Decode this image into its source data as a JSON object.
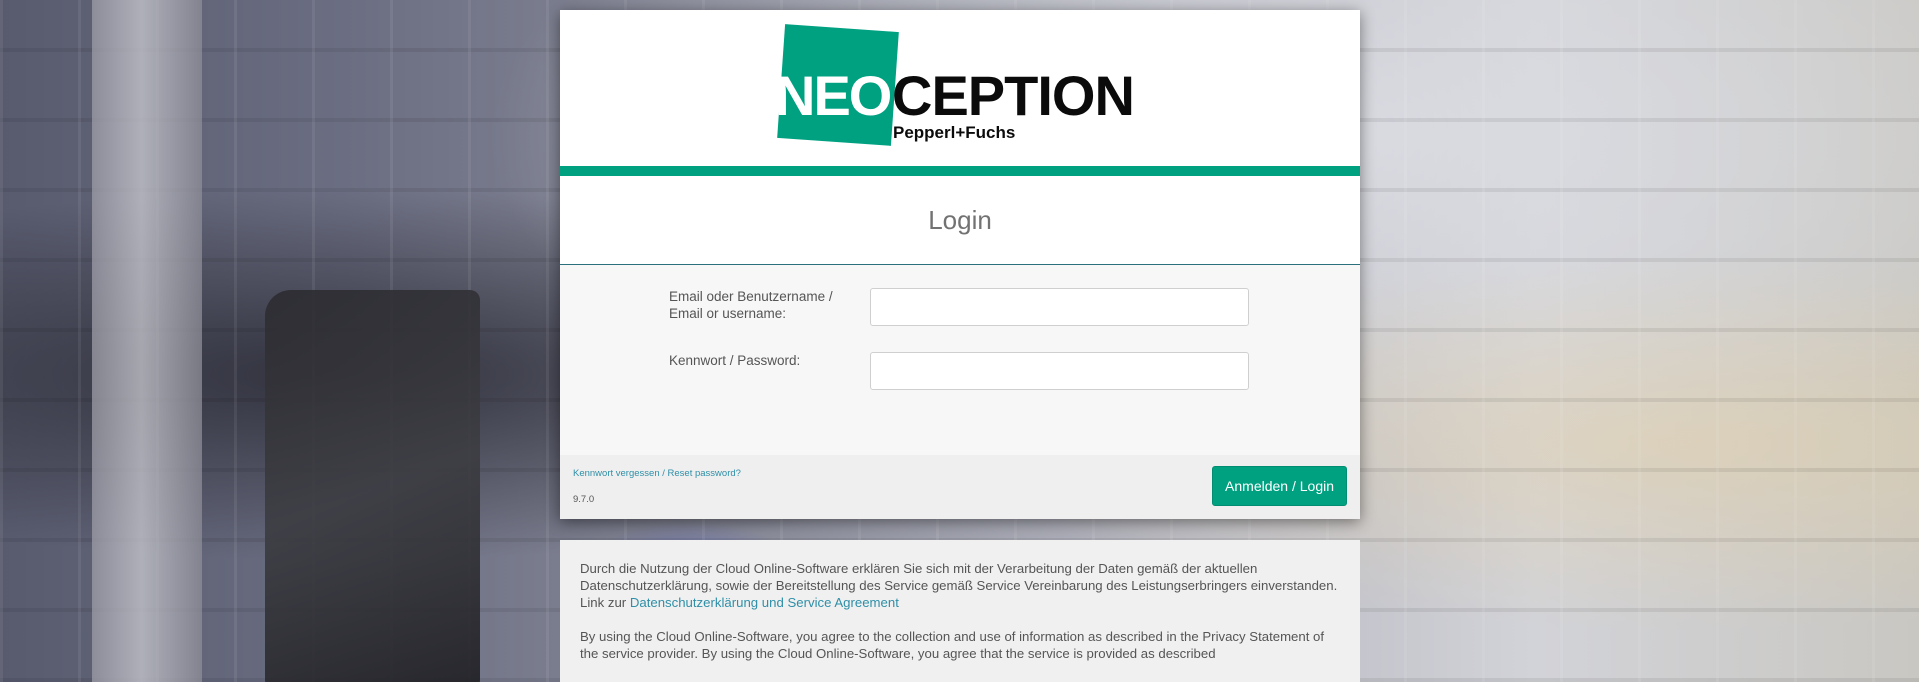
{
  "logo": {
    "brand_neo": "NEO",
    "brand_ception": "CEPTION",
    "brand_sub": "Pepperl+Fuchs"
  },
  "colors": {
    "brand_green": "#00a181",
    "link": "#2f8fa8"
  },
  "login": {
    "title": "Login",
    "username_label_de": "Email oder Benutzername /",
    "username_label_en": "Email or username:",
    "username_value": "",
    "password_label": "Kennwort / Password:",
    "password_value": "",
    "forgot_link": "Kennwort vergessen / Reset password?",
    "version": "9.7.0",
    "submit_label": "Anmelden / Login"
  },
  "notice": {
    "de_text": "Durch die Nutzung der Cloud Online-Software erklären Sie sich mit der Verarbeitung der Daten gemäß der aktuellen Datenschutzerklärung, sowie der Bereitstellung des Service gemäß Service Vereinbarung des Leistungserbringers einverstanden.",
    "link_prefix": "Link zur ",
    "link_text": "Datenschutzerklärung und Service Agreement",
    "en_text": "By using the Cloud Online-Software, you agree to the collection and use of information as described in the Privacy Statement of the service provider. By using the Cloud Online-Software, you agree that the service is provided as described"
  }
}
